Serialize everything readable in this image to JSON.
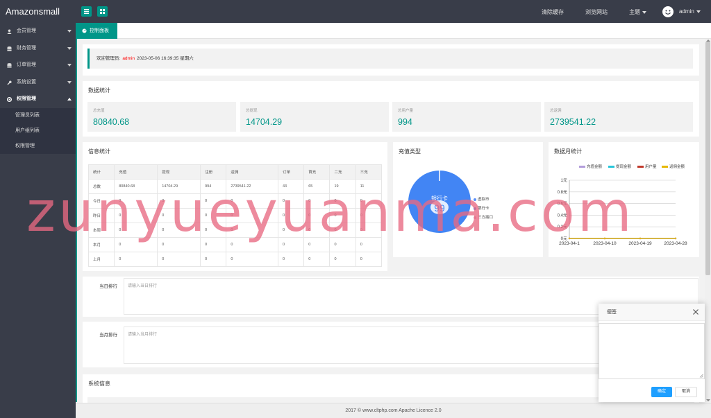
{
  "app": {
    "logo": "Amazonsmall"
  },
  "header": {
    "links": [
      "清除缓存",
      "浏览网站"
    ],
    "theme_label": "主题",
    "user": "admin"
  },
  "sidebar": {
    "items": [
      {
        "label": "会员管理",
        "icon": "user-icon"
      },
      {
        "label": "财务管理",
        "icon": "database-icon"
      },
      {
        "label": "订单管理",
        "icon": "database-icon"
      },
      {
        "label": "系统设置",
        "icon": "wrench-icon"
      },
      {
        "label": "权限管理",
        "icon": "gear-icon",
        "open": true
      }
    ],
    "sub_items": [
      "管理员列表",
      "用户组列表",
      "权限管理"
    ]
  },
  "tab": {
    "label": "控制面板"
  },
  "welcome": {
    "prefix": "欢迎管理员:",
    "user": "admin",
    "datetime": "2023-05-06  16:39:35  星期六"
  },
  "data_stats": {
    "title": "数据统计",
    "boxes": [
      {
        "label": "总充值",
        "value": "80840.68"
      },
      {
        "label": "总提现",
        "value": "14704.29"
      },
      {
        "label": "总用户量",
        "value": "994"
      },
      {
        "label": "总返佣",
        "value": "2739541.22"
      }
    ]
  },
  "info_stats": {
    "title": "信息统计",
    "headers": [
      "统计",
      "充值",
      "提现",
      "注册",
      "返佣",
      "订单",
      "首充",
      "二充",
      "三充"
    ],
    "rows": [
      [
        "总数",
        "80840.68",
        "14704.29",
        "994",
        "2739541.22",
        "43",
        "65",
        "19",
        "11"
      ],
      [
        "今日",
        "0",
        "0",
        "0",
        "0",
        "0",
        "0",
        "0",
        "0"
      ],
      [
        "昨日",
        "0",
        "0",
        "0",
        "0",
        "0",
        "0",
        "0",
        "0"
      ],
      [
        "本周",
        "0",
        "0",
        "0",
        "0",
        "0",
        "0",
        "0",
        "0"
      ],
      [
        "本月",
        "0",
        "0",
        "0",
        "0",
        "0",
        "0",
        "0",
        "0"
      ],
      [
        "上月",
        "0",
        "0",
        "0",
        "0",
        "0",
        "0",
        "0",
        "0"
      ]
    ]
  },
  "pie": {
    "title": "充值类型",
    "center_label": "银行卡",
    "center_value": "99",
    "colors": {
      "virtual": "#5b8ff9",
      "bank": "#4285f4",
      "third": "#e8a0b4"
    }
  },
  "line_chart": {
    "title": "数据月统计",
    "colors": {
      "recharge": "#b39ddb",
      "withdraw": "#26c6da",
      "users": "#c0392b",
      "rebate": "#e6b800"
    }
  },
  "chart_data": [
    {
      "type": "pie",
      "title": "充值类型",
      "labels": [
        "虚拟币",
        "银行卡",
        "三方接口"
      ],
      "values": [
        0,
        100,
        0
      ]
    },
    {
      "type": "line",
      "title": "数据月统计",
      "x": [
        "2023-04-1",
        "2023-04-10",
        "2023-04-19",
        "2023-04-28"
      ],
      "yticks": [
        "0元",
        "0.2元",
        "0.4元",
        "0.6元",
        "0.8元",
        "1元"
      ],
      "ylim": [
        0,
        1
      ],
      "series": [
        {
          "name": "充值金额",
          "values": [
            0,
            0,
            0,
            0
          ]
        },
        {
          "name": "提现金额",
          "values": [
            0,
            0,
            0,
            0
          ]
        },
        {
          "name": "用户量",
          "values": [
            0,
            0,
            0,
            0
          ]
        },
        {
          "name": "返佣金额",
          "values": [
            0,
            0,
            0,
            0
          ]
        }
      ],
      "legend": "top",
      "grid": true
    }
  ],
  "forms": {
    "daily": {
      "label": "当日排行",
      "placeholder": "请输入当日排行"
    },
    "monthly": {
      "label": "当月排行",
      "placeholder": "请输入当月排行"
    }
  },
  "system_info": {
    "title": "系统信息"
  },
  "footer": {
    "text": "2017 ©  www.cltphp.com  Apache Licence 2.0"
  },
  "modal": {
    "title": "便签",
    "ok": "确定",
    "cancel": "取消"
  },
  "watermark": "zunyueyuanma.com"
}
